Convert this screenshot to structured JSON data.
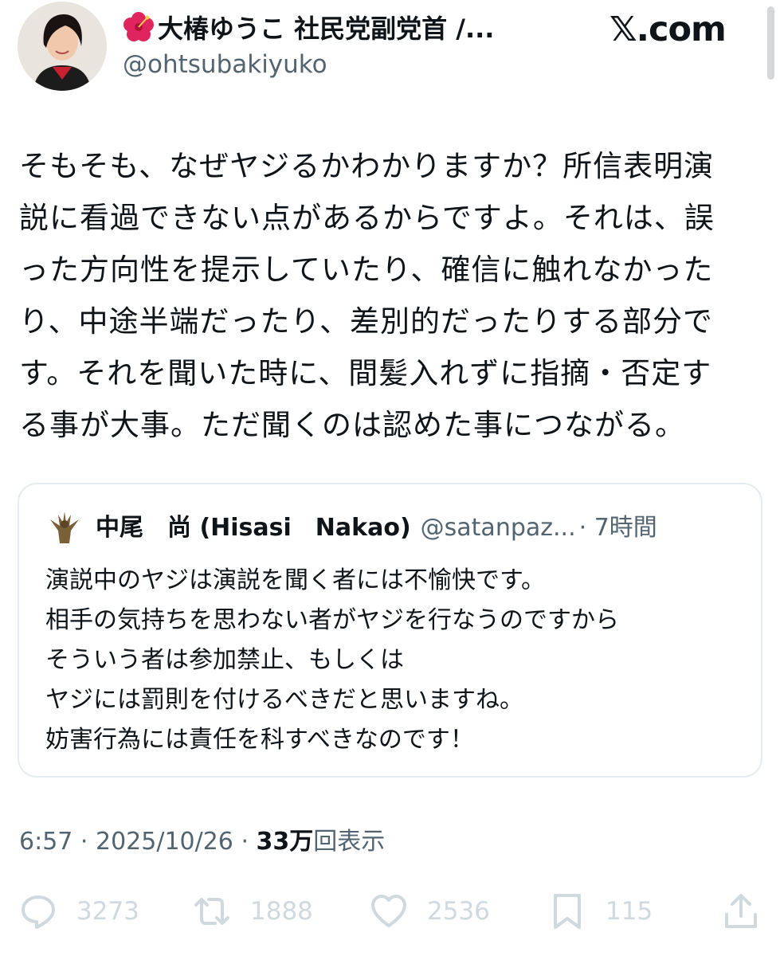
{
  "header": {
    "display_name": "大椿ゆうこ 社民党副党首 /...",
    "handle": "@ohtsubakiyuko",
    "site_logo": "𝕏.com",
    "flower_emoji_icon": "hibiscus-icon"
  },
  "tweet": {
    "text_lines": [
      "そもそも、なぜヤジるかわかりますか？所信表明演",
      "説に看過できない点があるからですよ。それは、誤",
      "った方向性を提示していたり、確信に触れなかった",
      "り、中途半端だったり、差別的だったりする部分で",
      "す。それを聞いた時に、間髪入れずに指摘・否定す",
      "る事が大事。ただ聞くのは認めた事につながる。"
    ]
  },
  "quote": {
    "name": "中尾　尚 (Hisasi　Nakao)",
    "handle": "@satanpaz...",
    "time": "· 7時間",
    "text_lines": [
      "演説中のヤジは演説を聞く者には不愉快です。",
      "相手の気持ちを思わない者がヤジを行なうのですから",
      "そういう者は参加禁止、もしくは",
      "ヤジには罰則を付けるべきだと思いますね。",
      "妨害行為には責任を科すべきなのです！"
    ]
  },
  "meta": {
    "time": "6:57",
    "separator": " · ",
    "date": "2025/10/26",
    "views_count": "33万",
    "views_label": "回表示"
  },
  "actions": {
    "reply_count": "3273",
    "retweet_count": "1888",
    "like_count": "2536",
    "bookmark_count": "115"
  },
  "colors": {
    "text": "#0f1419",
    "secondary": "#536471",
    "border": "#e6ecf0",
    "icon_muted": "#cfd9de",
    "flower": "#e0245e"
  }
}
